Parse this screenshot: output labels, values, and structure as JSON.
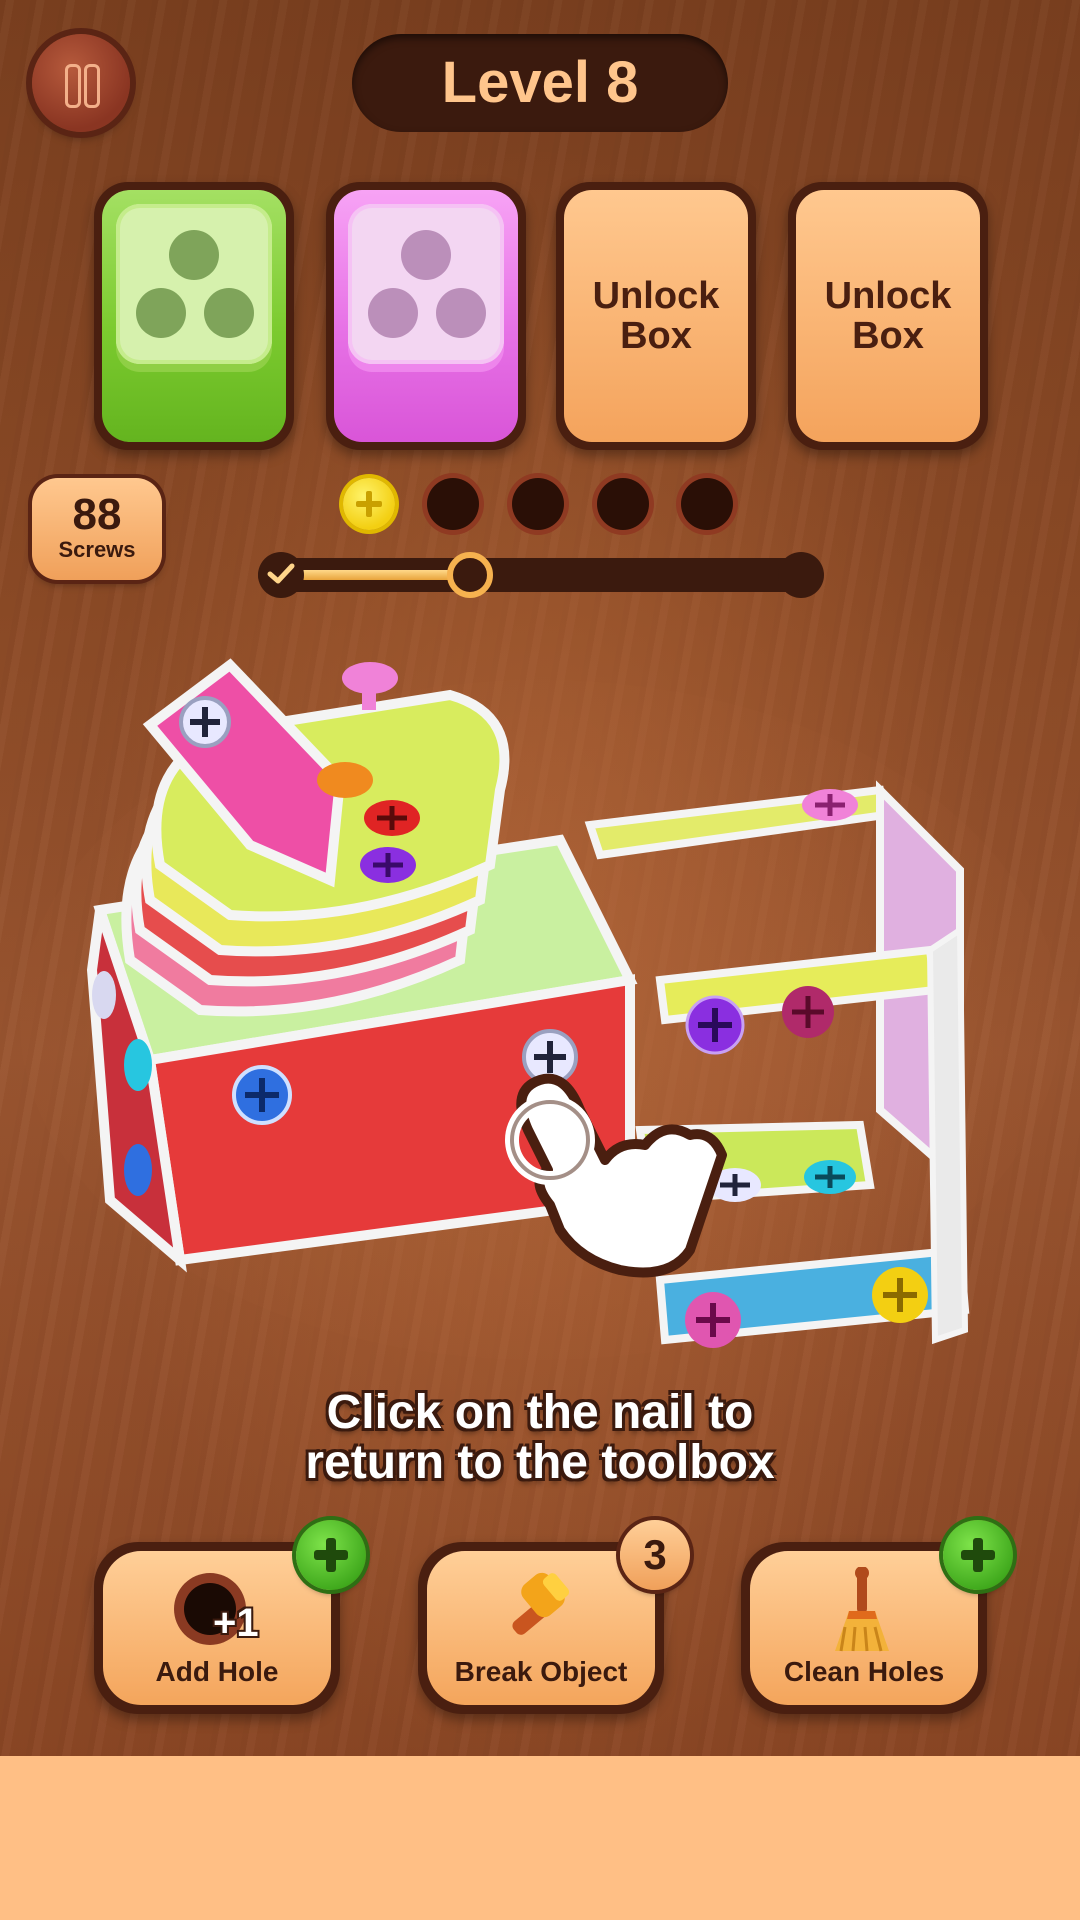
{
  "level": {
    "title": "Level 8"
  },
  "boxes": [
    {
      "state": "filled",
      "color": "green"
    },
    {
      "state": "filled",
      "color": "pink"
    },
    {
      "state": "locked",
      "label": "Unlock\nBox"
    },
    {
      "state": "locked",
      "label": "Unlock\nBox"
    }
  ],
  "screws": {
    "count": "88",
    "label": "Screws"
  },
  "holding_slots": {
    "total": 5,
    "filled": 1,
    "filled_screw_color": "yellow"
  },
  "progress": {
    "value": 0.37
  },
  "hint": {
    "line1": "Click on the nail to",
    "line2": "return to the toolbox"
  },
  "tools": {
    "add_hole": {
      "label": "Add Hole",
      "bonus": "+1",
      "badge": "plus"
    },
    "break_object": {
      "label": "Break Object",
      "badge_count": "3"
    },
    "clean_holes": {
      "label": "Clean Holes",
      "badge": "plus"
    }
  },
  "colors": {
    "wood": "#8c4a26",
    "button_orange": "#f4a55c",
    "accent_yellow": "#f3cf12",
    "plus_green": "#3fa81c",
    "bottom_panel": "#ffbf85"
  },
  "icons": [
    "pause-icon",
    "check-icon",
    "hole-icon",
    "hammer-icon",
    "broom-icon",
    "hand-pointer-icon"
  ]
}
